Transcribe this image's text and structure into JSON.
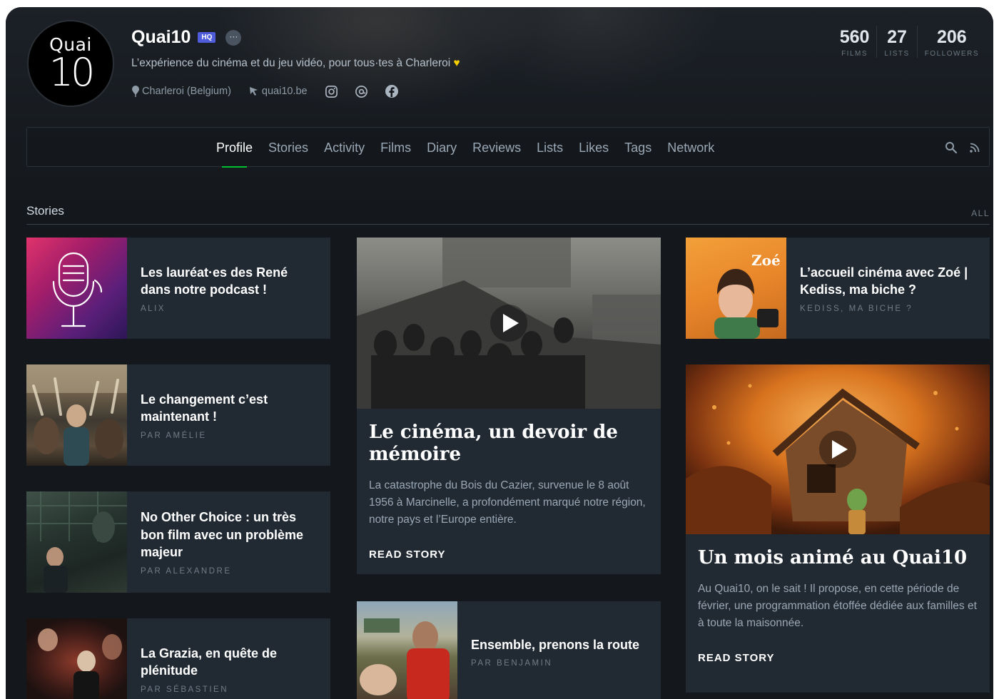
{
  "profile": {
    "avatar_line1": "Quai",
    "avatar_line2": "10",
    "name": "Quai10",
    "badge": "HQ",
    "more": "···",
    "bio": "L’expérience du cinéma et du jeu vidéo, pour tous·tes à Charleroi",
    "bio_emoji": "♥",
    "location": "Charleroi (Belgium)",
    "website": "quai10.be",
    "socials": [
      "instagram-icon",
      "threads-icon",
      "facebook-icon"
    ]
  },
  "stats": [
    {
      "num": "560",
      "label": "FILMS"
    },
    {
      "num": "27",
      "label": "LISTS"
    },
    {
      "num": "206",
      "label": "FOLLOWERS"
    }
  ],
  "nav": {
    "tabs": [
      "Profile",
      "Stories",
      "Activity",
      "Films",
      "Diary",
      "Reviews",
      "Lists",
      "Likes",
      "Tags",
      "Network"
    ],
    "active": "Profile",
    "accent": "#00c030"
  },
  "stories": {
    "heading": "Stories",
    "all_label": "ALL",
    "small": [
      {
        "title": "Les lauréat·es des René dans notre podcast !",
        "author": "ALIX"
      },
      {
        "title": "Le changement c’est maintenant !",
        "author": "PAR AMÉLIE"
      },
      {
        "title": "No Other Choice : un très bon film avec un problème majeur",
        "author": "PAR ALEXANDRE"
      },
      {
        "title": "La Grazia, en quête de plénitude",
        "author": "PAR SÉBASTIEN"
      },
      {
        "title": "L’accueil cinéma avec Zoé | Kediss, ma biche ?",
        "author": "KEDISS, MA BICHE ?",
        "thumb_text": "Zoé"
      },
      {
        "title": "Ensemble, prenons la route",
        "author": "PAR BENJAMIN"
      }
    ],
    "featured": [
      {
        "title": "Le cinéma, un devoir de mémoire",
        "desc": "La catastrophe du Bois du Cazier, survenue le 8 août 1956 à Marcinelle, a profondément marqué notre région, notre pays et l’Europe entière.",
        "cta": "READ STORY"
      },
      {
        "title": "Un mois animé au Quai10",
        "desc": "Au Quai10, on le sait ! Il propose, en cette période de février, une programmation étoffée dédiée aux familles et à toute la maisonnée.",
        "cta": "READ STORY"
      }
    ]
  }
}
